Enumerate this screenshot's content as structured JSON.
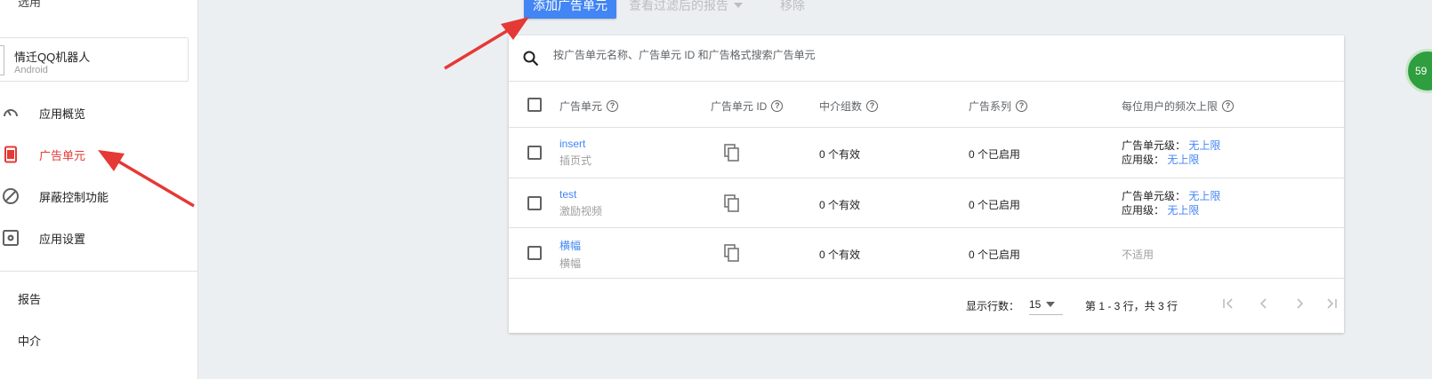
{
  "sidebar": {
    "top_item": "选用",
    "app": {
      "name": "情迁QQ机器人",
      "platform": "Android"
    },
    "nav": [
      {
        "label": "应用概览",
        "icon": "gauge-icon",
        "active": false
      },
      {
        "label": "广告单元",
        "icon": "ad-unit-icon",
        "active": true
      },
      {
        "label": "屏蔽控制功能",
        "icon": "block-icon",
        "active": false
      },
      {
        "label": "应用设置",
        "icon": "app-settings-icon",
        "active": false
      }
    ],
    "sub": [
      "报告",
      "中介"
    ]
  },
  "toolbar": {
    "add_label": "添加广告单元",
    "filtered_report_label": "查看过滤后的报告",
    "remove_label": "移除"
  },
  "search": {
    "placeholder": "按广告单元名称、广告单元 ID 和广告格式搜索广告单元"
  },
  "table": {
    "headers": [
      "广告单元",
      "广告单元 ID",
      "中介组数",
      "广告系列",
      "每位用户的频次上限"
    ],
    "rows": [
      {
        "name": "insert",
        "format": "插页式",
        "mediation": "0 个有效",
        "campaigns": "0 个已启用",
        "freq_unit_label": "广告单元级：",
        "freq_unit_value": "无上限",
        "freq_app_label": "应用级：",
        "freq_app_value": "无上限",
        "freq_na": ""
      },
      {
        "name": "test",
        "format": "激励视频",
        "mediation": "0 个有效",
        "campaigns": "0 个已启用",
        "freq_unit_label": "广告单元级：",
        "freq_unit_value": "无上限",
        "freq_app_label": "应用级：",
        "freq_app_value": "无上限",
        "freq_na": ""
      },
      {
        "name": "横幅",
        "format": "横幅",
        "mediation": "0 个有效",
        "campaigns": "0 个已启用",
        "freq_unit_label": "",
        "freq_unit_value": "",
        "freq_app_label": "",
        "freq_app_value": "",
        "freq_na": "不适用"
      }
    ]
  },
  "footer": {
    "rows_label": "显示行数：",
    "rows_value": "15",
    "range": "第 1 - 3 行，共 3 行"
  },
  "badge": {
    "text": "59"
  },
  "colors": {
    "accent": "#4285f4",
    "active": "#e53935",
    "arrow": "#e53935"
  }
}
